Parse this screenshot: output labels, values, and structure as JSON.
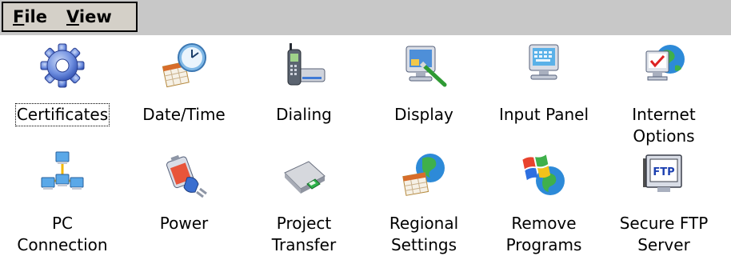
{
  "menu": {
    "file_label": "File",
    "view_label": "View"
  },
  "items": [
    {
      "line1": "Certificates",
      "line2": "",
      "icon": "gear-icon"
    },
    {
      "line1": "Date/Time",
      "line2": "",
      "icon": "calendar-clock-icon"
    },
    {
      "line1": "Dialing",
      "line2": "",
      "icon": "phone-modem-icon"
    },
    {
      "line1": "Display",
      "line2": "",
      "icon": "monitor-brush-icon"
    },
    {
      "line1": "Input Panel",
      "line2": "",
      "icon": "keyboard-monitor-icon"
    },
    {
      "line1": "Internet",
      "line2": "Options",
      "icon": "globe-check-icon"
    },
    {
      "line1": "PC",
      "line2": "Connection",
      "icon": "network-computers-icon"
    },
    {
      "line1": "Power",
      "line2": "",
      "icon": "battery-plug-icon"
    },
    {
      "line1": "Project",
      "line2": "Transfer",
      "icon": "card-reader-icon"
    },
    {
      "line1": "Regional",
      "line2": "Settings",
      "icon": "globe-calendar-icon"
    },
    {
      "line1": "Remove",
      "line2": "Programs",
      "icon": "windows-flag-icon"
    },
    {
      "line1": "Secure FTP",
      "line2": "Server",
      "icon": "ftp-monitor-icon"
    }
  ]
}
